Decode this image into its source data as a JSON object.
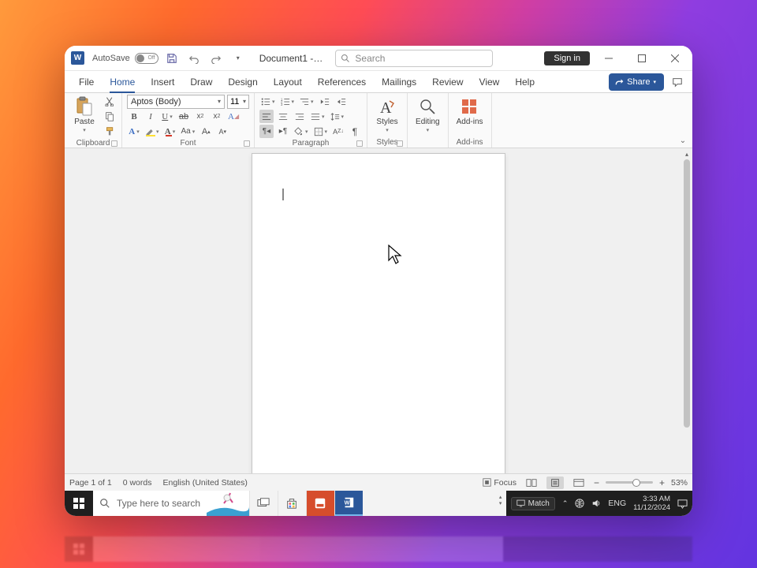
{
  "titlebar": {
    "autosave_label": "AutoSave",
    "autosave_state": "Off",
    "document_title": "Document1 -…",
    "search_placeholder": "Search",
    "signin_label": "Sign in"
  },
  "tabs": {
    "file": "File",
    "home": "Home",
    "insert": "Insert",
    "draw": "Draw",
    "design": "Design",
    "layout": "Layout",
    "references": "References",
    "mailings": "Mailings",
    "review": "Review",
    "view": "View",
    "help": "Help",
    "share": "Share"
  },
  "ribbon": {
    "clipboard": {
      "paste": "Paste",
      "group_label": "Clipboard"
    },
    "font": {
      "name": "Aptos (Body)",
      "size": "11",
      "group_label": "Font"
    },
    "paragraph": {
      "group_label": "Paragraph"
    },
    "styles": {
      "label": "Styles",
      "group_label": "Styles"
    },
    "editing": {
      "label": "Editing"
    },
    "addins": {
      "label": "Add-ins",
      "group_label": "Add-ins"
    }
  },
  "statusbar": {
    "page": "Page 1 of 1",
    "words": "0 words",
    "language": "English (United States)",
    "focus": "Focus",
    "zoom": "53%"
  },
  "taskbar": {
    "search_placeholder": "Type here to search",
    "match": "Match",
    "lang": "ENG",
    "time": "3:33 AM",
    "date": "11/12/2024"
  }
}
